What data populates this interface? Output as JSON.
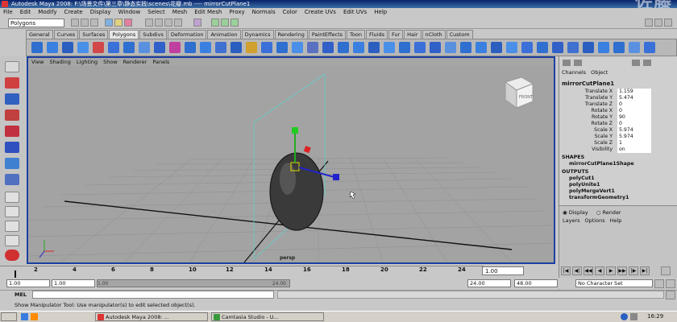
{
  "window": {
    "title": "Autodesk Maya 2008: F:\\场景文件\\第三章\\静态实践\\scenes\\花瓣.mb   ----   mirrorCutPlane1",
    "watermark": "佐藤"
  },
  "menubar": [
    "File",
    "Edit",
    "Modify",
    "Create",
    "Display",
    "Window",
    "Select",
    "Mesh",
    "Edit Mesh",
    "Proxy",
    "Normals",
    "Color",
    "Create UVs",
    "Edit UVs",
    "Help"
  ],
  "status": {
    "mode": "Polygons"
  },
  "shelf_tabs": [
    "General",
    "Curves",
    "Surfaces",
    "Polygons",
    "Subdivs",
    "Deformation",
    "Animation",
    "Dynamics",
    "Rendering",
    "PaintEffects",
    "Toon",
    "Fluids",
    "Fur",
    "Hair",
    "nCloth",
    "Custom"
  ],
  "active_shelf": "Polygons",
  "viewport": {
    "menu": [
      "View",
      "Shading",
      "Lighting",
      "Show",
      "Renderer",
      "Panels"
    ],
    "camera_label": "persp",
    "viewcube_label": "FRONT"
  },
  "channel_box": {
    "tabs": [
      "Channels",
      "Object"
    ],
    "object": "mirrorCutPlane1",
    "attributes": [
      {
        "name": "Translate X",
        "value": "1.159"
      },
      {
        "name": "Translate Y",
        "value": "5.474"
      },
      {
        "name": "Translate Z",
        "value": "0"
      },
      {
        "name": "Rotate X",
        "value": "0"
      },
      {
        "name": "Rotate Y",
        "value": "90"
      },
      {
        "name": "Rotate Z",
        "value": "0"
      },
      {
        "name": "Scale X",
        "value": "5.974"
      },
      {
        "name": "Scale Y",
        "value": "5.974"
      },
      {
        "name": "Scale Z",
        "value": "1"
      },
      {
        "name": "Visibility",
        "value": "on"
      }
    ],
    "shapes_header": "SHAPES",
    "shapes": [
      "mirrorCutPlane1Shape"
    ],
    "outputs_header": "OUTPUTS",
    "outputs": [
      "polyCut1",
      "polyUnite1",
      "polyMergeVert1",
      "transformGeometry1"
    ]
  },
  "layer_editor": {
    "radio": [
      "Display",
      "Render"
    ],
    "menu": [
      "Layers",
      "Options",
      "Help"
    ]
  },
  "time_slider": {
    "ticks": [
      "2",
      "4",
      "6",
      "8",
      "10",
      "12",
      "14",
      "16",
      "18",
      "20",
      "22",
      "24"
    ],
    "current_frame": "1.00"
  },
  "range": {
    "start": "1.00",
    "inner_start": "1.00",
    "slider_start": "1.00",
    "slider_end": "24.00",
    "end": "24.00",
    "end2": "48.00",
    "character_set": "No Character Set"
  },
  "command_line": {
    "label": "MEL"
  },
  "help_line": "Show Manipulator Tool: Use manipulator(s) to edit selected object(s).",
  "taskbar": {
    "items": [
      "Autodesk Maya 2008: ...",
      "Camtasia Studio - U..."
    ],
    "clock": "16:29"
  }
}
